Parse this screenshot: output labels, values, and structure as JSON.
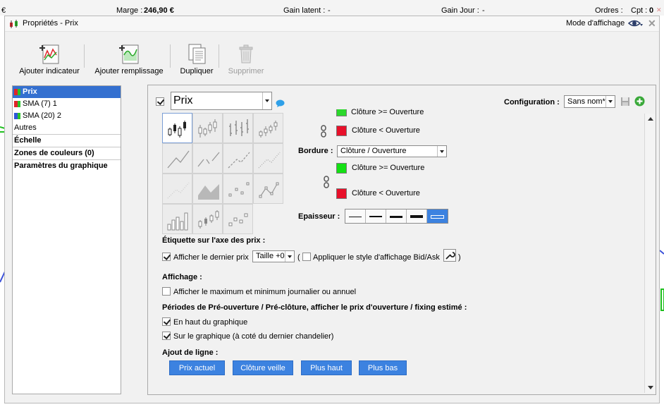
{
  "status": {
    "currency_symbol": "€",
    "margin_label": "Marge :",
    "margin_value": "246,90 €",
    "unrealized_label": "Gain latent :",
    "unrealized_value": "-",
    "day_gain_label": "Gain Jour :",
    "day_gain_value": "-",
    "orders_label": "Ordres :",
    "count_label": "Cpt :",
    "count_value": "0"
  },
  "dialog": {
    "title": "Propriétés - Prix",
    "display_mode": "Mode d'affichage"
  },
  "toolbar": {
    "add_indicator": "Ajouter indicateur",
    "add_fill": "Ajouter remplissage",
    "duplicate": "Dupliquer",
    "delete": "Supprimer"
  },
  "left_panel": {
    "items": [
      {
        "label": "Prix",
        "colors": [
          "#e0242a",
          "#29c229"
        ]
      },
      {
        "label": "SMA (7) 1",
        "colors": [
          "#e0242a",
          "#29c229"
        ]
      },
      {
        "label": "SMA (20) 2",
        "colors": [
          "#2f56d8",
          "#29c229"
        ]
      },
      {
        "label": "Autres"
      }
    ],
    "sections": [
      "Échelle",
      "Zones de couleurs (0)",
      "Paramètres du graphique"
    ]
  },
  "main": {
    "series_select": "Prix",
    "configuration_label": "Configuration :",
    "configuration_value": "Sans nom*",
    "rise_label_top": "Clôture >= Ouverture",
    "fall_label_top": "Clôture < Ouverture",
    "border_label": "Bordure :",
    "border_value": "Clôture / Ouverture",
    "rise_label": "Clôture >= Ouverture",
    "fall_label": "Clôture < Ouverture",
    "thickness_label": "Epaisseur :",
    "colors": {
      "rise": "#2bd82b",
      "fall": "#e8102a",
      "rise_border": "#14e014",
      "fall_border": "#e8102a",
      "accent": "#3c82e0"
    },
    "price_axis_heading": "Étiquette sur l'axe des prix :",
    "show_last_price": "Afficher le dernier prix",
    "size_value": "Taille +0",
    "paren_open": "(",
    "bid_ask_style": "Appliquer le style d'affichage Bid/Ask",
    "paren_close": ")",
    "display_heading": "Affichage :",
    "show_max_min": "Afficher le maximum et minimum journalier ou annuel",
    "preopen_heading": "Périodes de Pré-ouverture / Pré-clôture, afficher le prix d'ouverture / fixing estimé :",
    "top_of_chart": "En haut du graphique",
    "on_chart": "Sur le graphique (à coté du dernier chandelier)",
    "add_line_heading": "Ajout de ligne :",
    "line_buttons": [
      "Prix actuel",
      "Clôture veille",
      "Plus haut",
      "Plus bas"
    ]
  }
}
